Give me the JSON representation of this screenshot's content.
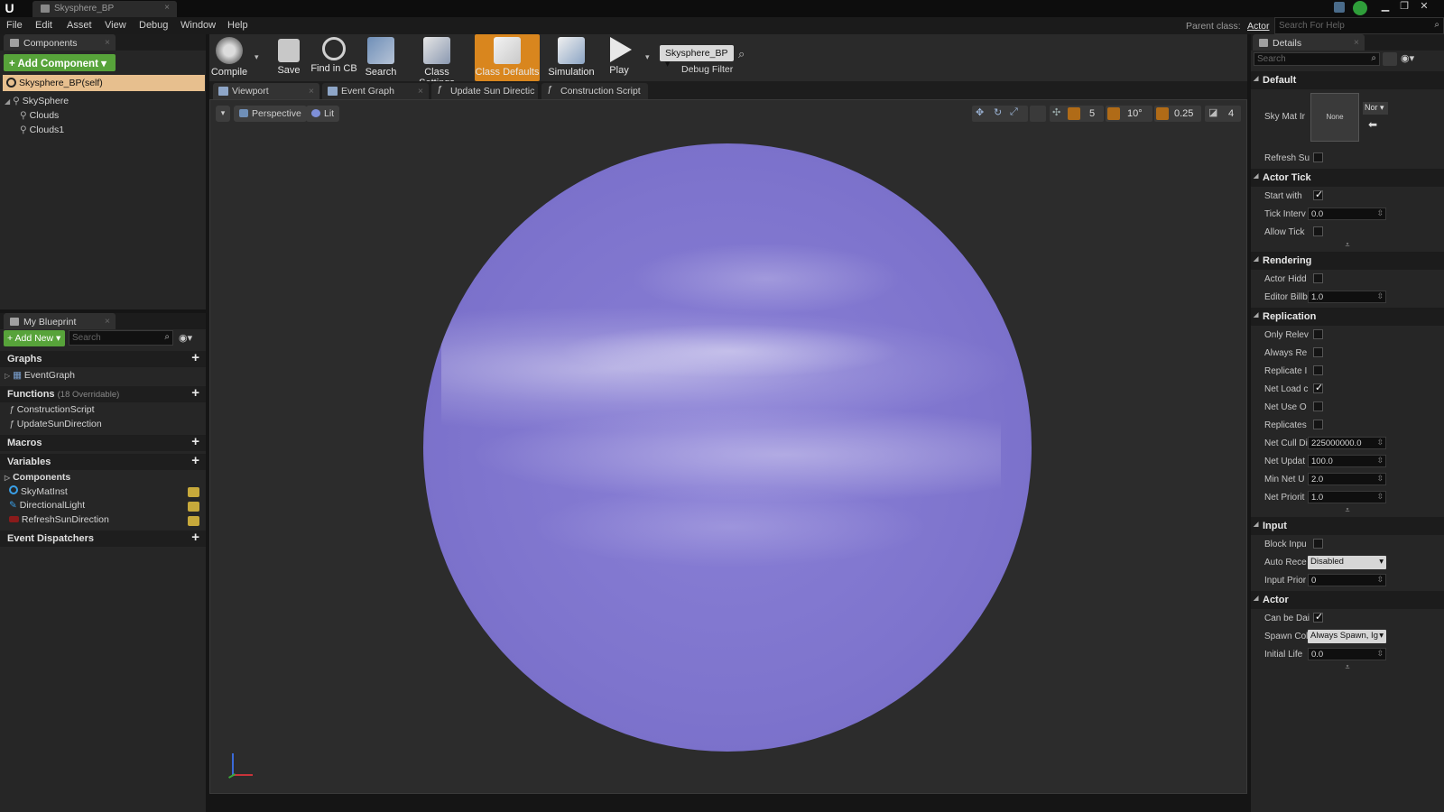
{
  "window": {
    "doc_tab": "Skysphere_BP",
    "minimize": "▁",
    "maximize": "❐",
    "close": "✕"
  },
  "menu": {
    "items": [
      "File",
      "Edit",
      "Asset",
      "View",
      "Debug",
      "Window",
      "Help"
    ],
    "parent_class_label": "Parent class:",
    "parent_class_value": "Actor",
    "help_search_placeholder": "Search For Help"
  },
  "components_panel": {
    "tab": "Components",
    "add_component": "+ Add Component ▾",
    "self_item": "Skysphere_BP(self)",
    "tree": [
      "SkySphere",
      "Clouds",
      "Clouds1"
    ]
  },
  "my_blueprint": {
    "tab": "My Blueprint",
    "add_new": "+ Add New ▾",
    "search_placeholder": "Search",
    "graphs_label": "Graphs",
    "graphs": [
      "EventGraph"
    ],
    "functions_label": "Functions",
    "functions_count": "(18 Overridable)",
    "functions": [
      "ConstructionScript",
      "UpdateSunDirection"
    ],
    "macros_label": "Macros",
    "variables_label": "Variables",
    "components_sub": "Components",
    "variables": [
      "SkyMatInst",
      "DirectionalLight",
      "RefreshSunDirection"
    ],
    "dispatchers_label": "Event Dispatchers"
  },
  "toolbar": {
    "buttons": [
      "Compile",
      "Save",
      "Find in CB",
      "Search",
      "Class Settings",
      "Class Defaults",
      "Simulation",
      "Play"
    ],
    "debug_object": "Skysphere_BP ▾",
    "debug_filter": "Debug Filter",
    "active_color": "#d9861e"
  },
  "editor_tabs": [
    "Viewport",
    "Event Graph",
    "Update Sun Directic",
    "Construction Script"
  ],
  "viewport": {
    "perspective": "Perspective",
    "lit": "Lit",
    "grid_snap": "5",
    "rot_snap": "10°",
    "scale_snap": "0.25",
    "cam_speed": "4",
    "sphere_color": "#8277d0"
  },
  "details": {
    "tab": "Details",
    "search_placeholder": "Search",
    "sections": {
      "default": "Default",
      "actor_tick": "Actor Tick",
      "rendering": "Rendering",
      "replication": "Replication",
      "input": "Input",
      "actor": "Actor"
    },
    "sky_mat_label": "Sky Mat Ir",
    "sky_mat_thumb": "None",
    "sky_mat_select": "Nor ▾",
    "refresh": "Refresh Su",
    "start_with": "Start with",
    "tick_interval": "Tick Interv",
    "tick_interval_value": "0.0",
    "allow_tick": "Allow Tick",
    "actor_hidden": "Actor Hidd",
    "editor_billboard": "Editor Billb",
    "editor_billboard_value": "1.0",
    "only_relevant": "Only Relev",
    "always_relevant": "Always Re",
    "replicate_movement": "Replicate I",
    "net_load": "Net Load c",
    "net_use_owner": "Net Use O",
    "replicates": "Replicates",
    "net_cull": "Net Cull Di",
    "net_cull_value": "225000000.0",
    "net_update": "Net Updat",
    "net_update_value": "100.0",
    "min_net_update": "Min Net U",
    "min_net_update_value": "2.0",
    "net_priority": "Net Priorit",
    "net_priority_value": "1.0",
    "block_input": "Block Inpu",
    "auto_receive": "Auto Rece",
    "auto_receive_value": "Disabled",
    "input_priority": "Input Prior",
    "input_priority_value": "0",
    "can_be_damaged": "Can be Dai",
    "spawn_collision": "Spawn Col",
    "spawn_collision_value": "Always Spawn, Ig",
    "initial_life": "Initial Life",
    "initial_life_value": "0.0"
  }
}
